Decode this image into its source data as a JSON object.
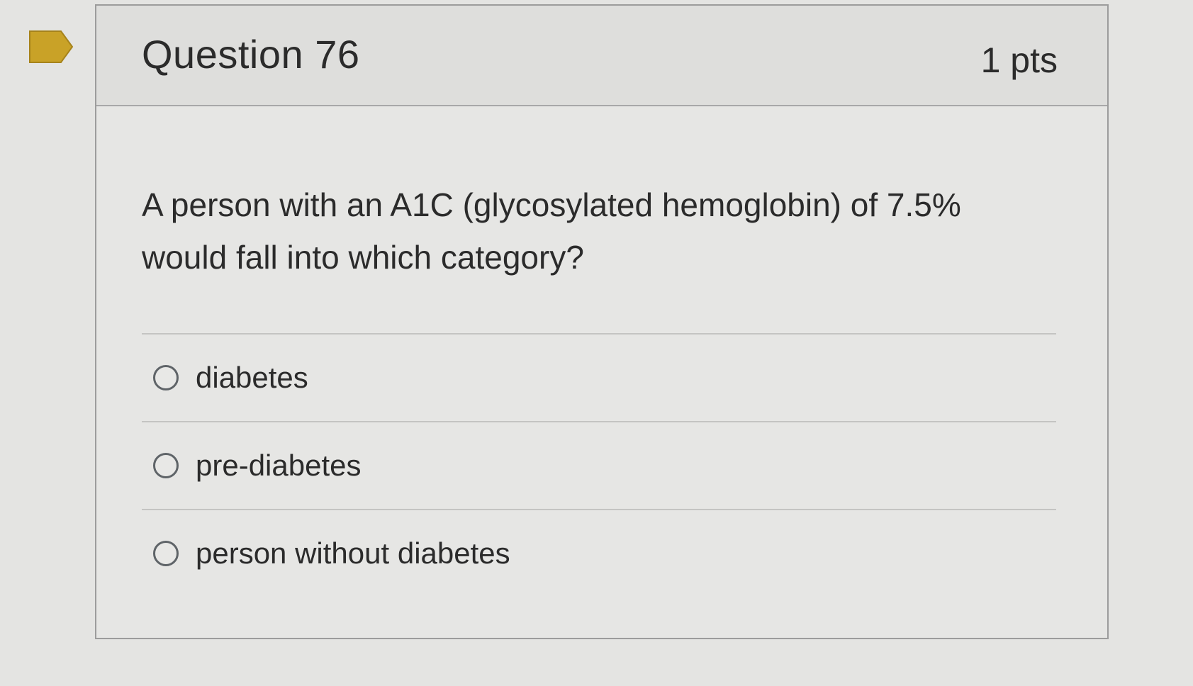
{
  "question": {
    "title": "Question 76",
    "points": "1 pts",
    "text": "A person with an A1C (glycosylated hemoglobin) of 7.5% would fall into which category?",
    "answers": [
      {
        "label": "diabetes",
        "selected": false
      },
      {
        "label": "pre-diabetes",
        "selected": false
      },
      {
        "label": "person without diabetes",
        "selected": false
      }
    ]
  },
  "colors": {
    "flag": "#c9a227",
    "flag_stroke": "#a6831b",
    "text": "#2b2b2b",
    "border": "#9c9c9c"
  },
  "icons": {
    "flag": "bookmark-flag-icon",
    "radio": "radio-button-icon"
  }
}
